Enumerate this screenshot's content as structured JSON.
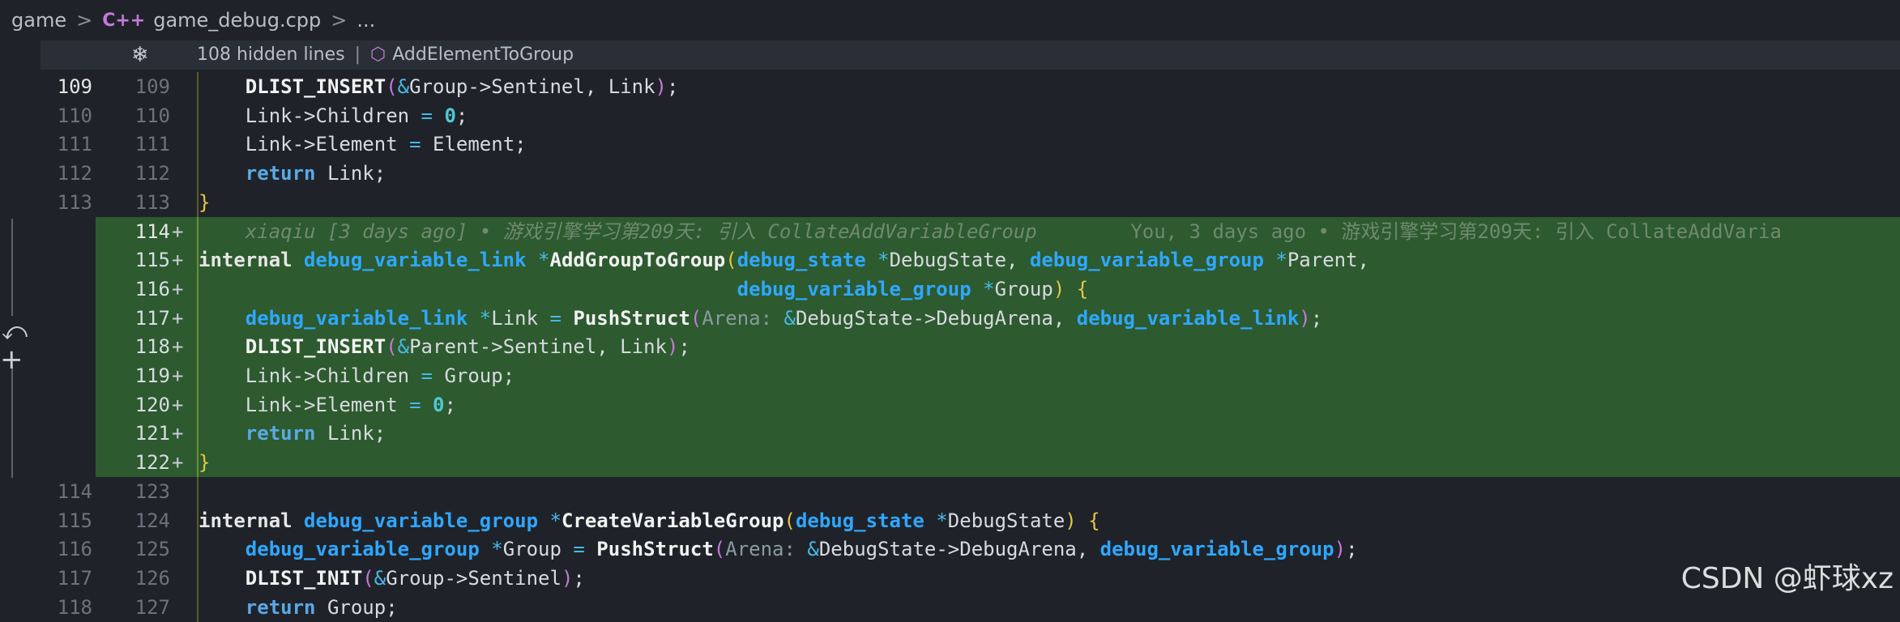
{
  "breadcrumb": {
    "folder": "game",
    "file": "game_debug.cpp",
    "more": "..."
  },
  "hidden_bar": {
    "count_text": "108 hidden lines",
    "function": "AddElementToGroup"
  },
  "blame": {
    "author": "xiaqiu [3 days ago] • 游戏引擎学习第209天: 引入 CollateAddVariableGroup",
    "inline": "You, 3 days ago • 游戏引擎学习第209天: 引入 CollateAddVaria"
  },
  "lines": [
    {
      "l": "109",
      "r": "109"
    },
    {
      "l": "110",
      "r": "110"
    },
    {
      "l": "111",
      "r": "111"
    },
    {
      "l": "112",
      "r": "112"
    },
    {
      "l": "113",
      "r": "113"
    },
    {
      "l": "",
      "r": "114+"
    },
    {
      "l": "",
      "r": "115+"
    },
    {
      "l": "",
      "r": "116+"
    },
    {
      "l": "",
      "r": "117+"
    },
    {
      "l": "",
      "r": "118+"
    },
    {
      "l": "",
      "r": "119+"
    },
    {
      "l": "",
      "r": "120+"
    },
    {
      "l": "",
      "r": "121+"
    },
    {
      "l": "",
      "r": "122+"
    },
    {
      "l": "114",
      "r": "123"
    },
    {
      "l": "115",
      "r": "124"
    },
    {
      "l": "116",
      "r": "125"
    },
    {
      "l": "117",
      "r": "126"
    },
    {
      "l": "118",
      "r": "127"
    }
  ],
  "code": {
    "l0": [
      "DLIST_INSERT",
      "(",
      "&",
      "Group->Sentinel, Link",
      ")",
      ";"
    ],
    "l1": [
      "Link->Children ",
      "=",
      " ",
      "0",
      ";"
    ],
    "l2": [
      "Link->Element ",
      "=",
      " Element;"
    ],
    "l3": [
      "return",
      " Link;"
    ],
    "l4": [
      "}"
    ],
    "l6": [
      "internal",
      " ",
      "debug_variable_link",
      " ",
      "*",
      "AddGroupToGroup",
      "(",
      "debug_state",
      " ",
      "*",
      "DebugState, ",
      "debug_variable_group",
      " ",
      "*",
      "Parent,"
    ],
    "l7": [
      "debug_variable_group",
      " ",
      "*",
      "Group",
      ")",
      " ",
      "{"
    ],
    "l8": [
      "debug_variable_link",
      " ",
      "*",
      "Link ",
      "=",
      " ",
      "PushStruct",
      "(",
      "Arena:",
      " ",
      "&",
      "DebugState->DebugArena, ",
      "debug_variable_link",
      ")",
      ";"
    ],
    "l9": [
      "DLIST_INSERT",
      "(",
      "&",
      "Parent->Sentinel, Link",
      ")",
      ";"
    ],
    "l10": [
      "Link->Children ",
      "=",
      " Group;"
    ],
    "l11": [
      "Link->Element ",
      "=",
      " ",
      "0",
      ";"
    ],
    "l12": [
      "return",
      " Link;"
    ],
    "l13": [
      "}"
    ],
    "l15": [
      "internal",
      " ",
      "debug_variable_group",
      " ",
      "*",
      "CreateVariableGroup",
      "(",
      "debug_state",
      " ",
      "*",
      "DebugState",
      ")",
      " ",
      "{"
    ],
    "l16": [
      "debug_variable_group",
      " ",
      "*",
      "Group ",
      "=",
      " ",
      "PushStruct",
      "(",
      "Arena:",
      " ",
      "&",
      "DebugState->DebugArena, ",
      "debug_variable_group",
      ")",
      ";"
    ],
    "l17": [
      "DLIST_INIT",
      "(",
      "&",
      "Group->Sentinel",
      ")",
      ";"
    ],
    "l18": [
      "return",
      " Group;"
    ]
  },
  "watermark": "CSDN @虾球xz",
  "icons": {
    "snowflake": "collapse-icon",
    "cube": "symbol-icon",
    "undo": "revert-icon",
    "plus": "add-icon"
  }
}
